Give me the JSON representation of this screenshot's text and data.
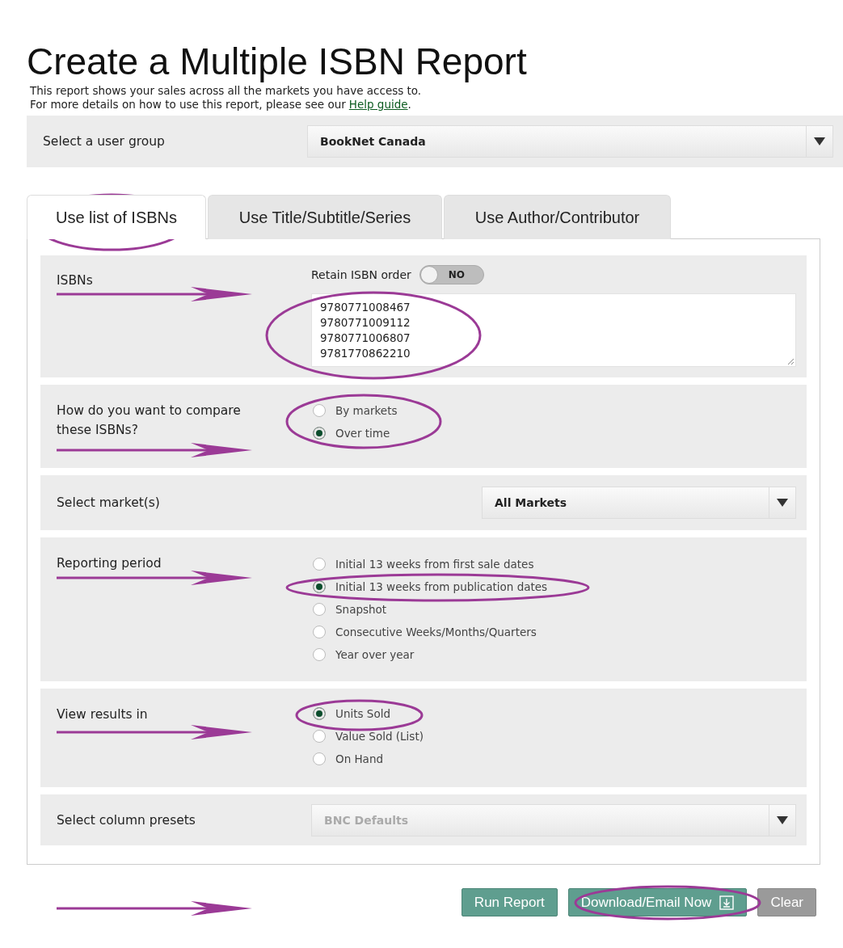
{
  "title": "Create a Multiple ISBN Report",
  "intro": {
    "line1": "This report shows your sales across all the markets you have access to.",
    "line2": "For more details on how to use this report, please see our",
    "link": "Help guide",
    "after": "."
  },
  "user_group": {
    "label": "Select a user group",
    "value": "BookNet Canada"
  },
  "tabs": [
    {
      "label": "Use list of ISBNs",
      "selected": true
    },
    {
      "label": "Use Title/Subtitle/Series",
      "selected": false
    },
    {
      "label": "Use Author/Contributor",
      "selected": false
    }
  ],
  "sections": [
    {
      "kind": "isbns",
      "label": "ISBNs",
      "toggle": {
        "label": "Retain ISBN order",
        "on": false,
        "text": "NO"
      },
      "isbns": [
        "9780771008467",
        "9780771009112",
        "9780771006807",
        "9781770862210"
      ]
    },
    {
      "kind": "radios",
      "label": "How do you want to compare these ISBNs?",
      "options": [
        {
          "label": "By markets",
          "selected": false
        },
        {
          "label": "Over time",
          "selected": true
        }
      ]
    },
    {
      "kind": "select",
      "label": "Select market(s)",
      "value": "All Markets",
      "disabled": false,
      "wide": false
    },
    {
      "kind": "radios",
      "label": "Reporting period",
      "options": [
        {
          "label": "Initial 13 weeks from first sale dates",
          "selected": false
        },
        {
          "label": "Initial 13 weeks from publication dates",
          "selected": true
        },
        {
          "label": "Snapshot",
          "selected": false
        },
        {
          "label": "Consecutive Weeks/Months/Quarters",
          "selected": false
        },
        {
          "label": "Year over year",
          "selected": false
        }
      ]
    },
    {
      "kind": "radios",
      "label": "View results in",
      "options": [
        {
          "label": "Units Sold",
          "selected": true
        },
        {
          "label": "Value Sold (List)",
          "selected": false
        },
        {
          "label": "On Hand",
          "selected": false
        }
      ]
    },
    {
      "kind": "select",
      "label": "Select column presets",
      "value": "BNC Defaults",
      "disabled": true,
      "wide": true
    }
  ],
  "buttons": [
    {
      "label": "Run Report",
      "kind": "primary"
    },
    {
      "label": "Download/Email Now",
      "kind": "download"
    },
    {
      "label": "Clear",
      "kind": "secondary"
    }
  ]
}
